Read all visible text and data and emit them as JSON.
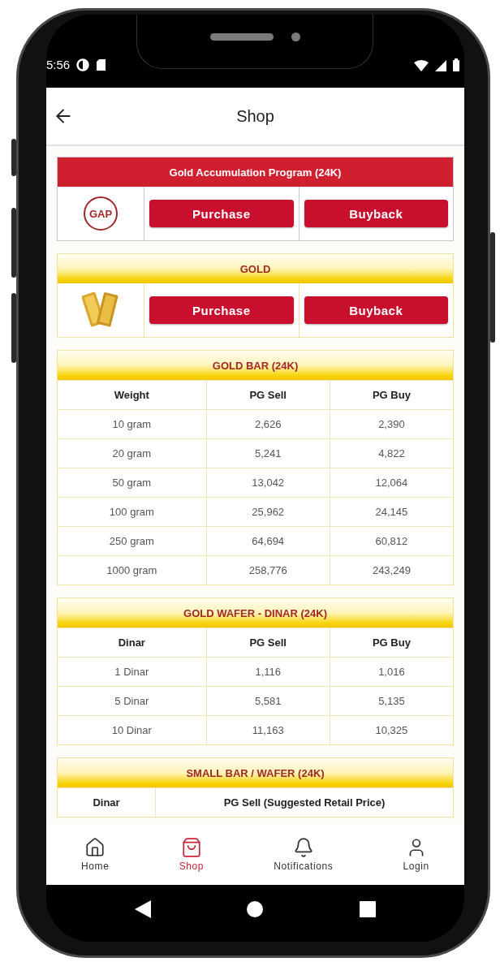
{
  "status_bar": {
    "time": "5:56"
  },
  "app_bar": {
    "title": "Shop"
  },
  "sections": [
    {
      "kind": "program",
      "title": "Gold Accumulation Program (24K)",
      "badge": "GAP",
      "buttons": [
        "Purchase",
        "Buyback"
      ]
    },
    {
      "kind": "product",
      "title": "GOLD",
      "buttons": [
        "Purchase",
        "Buyback"
      ]
    },
    {
      "kind": "table",
      "title": "GOLD BAR (24K)",
      "columns": [
        "Weight",
        "PG Sell",
        "PG Buy"
      ],
      "rows": [
        [
          "10 gram",
          "2,626",
          "2,390"
        ],
        [
          "20 gram",
          "5,241",
          "4,822"
        ],
        [
          "50 gram",
          "13,042",
          "12,064"
        ],
        [
          "100 gram",
          "25,962",
          "24,145"
        ],
        [
          "250 gram",
          "64,694",
          "60,812"
        ],
        [
          "1000 gram",
          "258,776",
          "243,249"
        ]
      ]
    },
    {
      "kind": "table",
      "title": "GOLD WAFER - DINAR (24K)",
      "columns": [
        "Dinar",
        "PG Sell",
        "PG Buy"
      ],
      "rows": [
        [
          "1 Dinar",
          "1,116",
          "1,016"
        ],
        [
          "5 Dinar",
          "5,581",
          "5,135"
        ],
        [
          "10 Dinar",
          "11,163",
          "10,325"
        ]
      ]
    },
    {
      "kind": "table",
      "title": "SMALL BAR / WAFER (24K)",
      "columns": [
        "Dinar",
        "PG Sell (Suggested Retail Price)"
      ]
    }
  ],
  "nav": {
    "items": [
      {
        "label": "Home",
        "selected": false
      },
      {
        "label": "Shop",
        "selected": true
      },
      {
        "label": "Notifications",
        "selected": false
      },
      {
        "label": "Login",
        "selected": false
      }
    ]
  }
}
